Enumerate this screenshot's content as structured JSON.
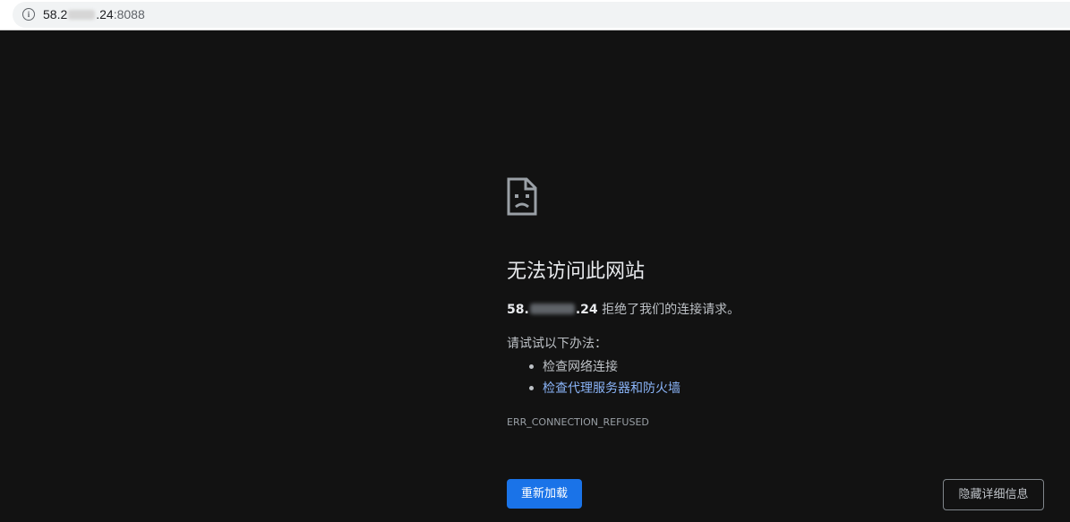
{
  "address_bar": {
    "url_prefix": "58.2",
    "url_suffix": ".24",
    "url_port": ":8088",
    "info_icon": "info-icon"
  },
  "main": {
    "page_icon": "sad-page-icon",
    "heading": "无法访问此网站",
    "host_prefix": "58.",
    "host_suffix": ".24",
    "refused_text": " 拒绝了我们的连接请求。",
    "try_label": "请试试以下办法：",
    "suggestions": [
      {
        "text": "检查网络连接",
        "is_link": false
      },
      {
        "text": "检查代理服务器和防火墙",
        "is_link": true
      }
    ],
    "error_code": "ERR_CONNECTION_REFUSED"
  },
  "buttons": {
    "reload": "重新加载",
    "details": "隐藏详细信息"
  },
  "colors": {
    "background": "#121212",
    "heading": "#e8eaed",
    "body_text": "#bdc1c6",
    "link": "#8ab4f8",
    "primary_button": "#1a73e8"
  }
}
